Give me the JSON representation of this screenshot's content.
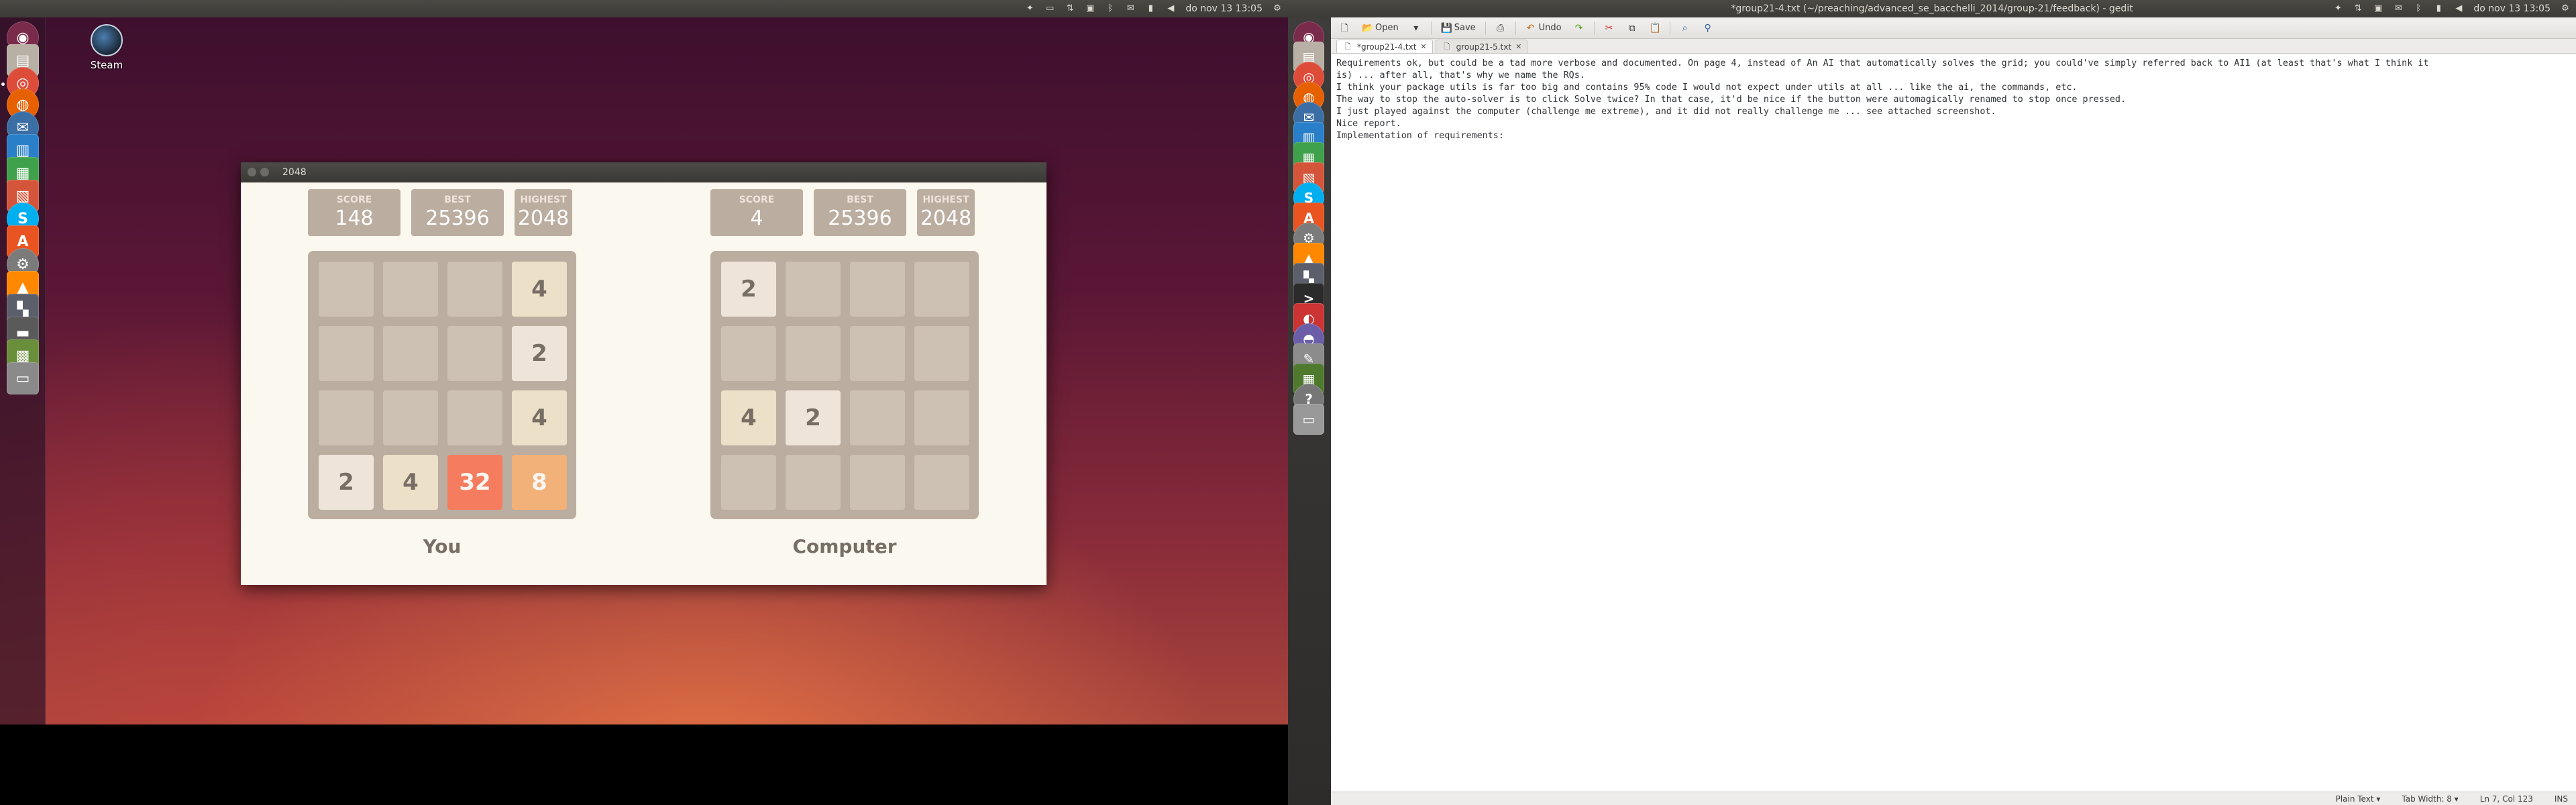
{
  "left_monitor": {
    "topbar": {
      "window_title": "",
      "clock": "do nov 13 13:05"
    },
    "desktop_icons": [
      {
        "label": "Steam",
        "icon": "steam-icon"
      }
    ],
    "launcher_icons": [
      "ubuntu-dash-icon",
      "files-icon",
      "chrome-icon",
      "firefox-icon",
      "thunderbird-icon",
      "writer-icon",
      "calc-icon",
      "impress-icon",
      "skype-icon",
      "software-center-icon",
      "system-settings-icon",
      "vlc-icon",
      "app-icon",
      "scanner-icon",
      "game-icon",
      "drive-icon"
    ],
    "game_window": {
      "title": "2048",
      "player": {
        "score_label": "SCORE",
        "score": "148",
        "best_label": "BEST",
        "best": "25396",
        "highest_label": "HIGHEST",
        "highest": "2048",
        "label": "You",
        "grid": [
          [
            "",
            "",
            "",
            "4"
          ],
          [
            "",
            "",
            "",
            "2"
          ],
          [
            "",
            "",
            "",
            "4"
          ],
          [
            "2",
            "4",
            "32",
            "8"
          ]
        ]
      },
      "computer": {
        "score_label": "SCORE",
        "score": "4",
        "best_label": "BEST",
        "best": "25396",
        "highest_label": "HIGHEST",
        "highest": "2048",
        "label": "Computer",
        "grid": [
          [
            "2",
            "",
            "",
            ""
          ],
          [
            "",
            "",
            "",
            ""
          ],
          [
            "4",
            "2",
            "",
            ""
          ],
          [
            "",
            "",
            "",
            ""
          ]
        ]
      },
      "tile_colors": {
        "empty": "#cdc1b4",
        "2": "#eee4da",
        "4": "#ede0c8",
        "8": "#f2b179",
        "32": "#f67c5f",
        "board": "#bbada0",
        "background": "#faf8ef"
      }
    }
  },
  "right_monitor": {
    "topbar": {
      "window_title": "*group21-4.txt (~/preaching/advanced_se_bacchelli_2014/group-21/feedback) - gedit",
      "clock": "do nov 13 13:05"
    },
    "launcher_icons": [
      "ubuntu-dash-icon",
      "files-icon",
      "chrome-icon",
      "firefox-icon",
      "thunderbird-icon",
      "writer-icon",
      "calc-icon",
      "impress-icon",
      "skype-icon",
      "software-center-icon",
      "system-settings-icon",
      "vlc-icon",
      "image-viewer-icon",
      "terminal-icon",
      "app-icon",
      "disk-icon",
      "text-editor-icon",
      "workspaces-icon",
      "help-icon",
      "trash-icon"
    ],
    "gedit": {
      "toolbar": {
        "open_label": "Open",
        "save_label": "Save",
        "undo_label": "Undo"
      },
      "tabs": [
        {
          "label": "*group21-4.txt",
          "active": true
        },
        {
          "label": "group21-5.txt",
          "active": false
        }
      ],
      "lines": [
        "Requirements ok, but could be a tad more verbose and documented. On page 4, instead of An AI that automatically solves the grid; you could've simply referred back to AI1 (at least that's what I think it",
        "is) ... after all, that's why we name the RQs.",
        "",
        "I think your package utils is far too big and contains 95% code I would not expect under utils at all ... like the ai, the commands, etc.",
        "",
        "The way to stop the auto-solver is to click Solve twice? In that case, it'd be nice if the button were automagically renamed to stop once pressed.",
        "",
        "I just played against the computer (challenge me extreme), and it did not really challenge me ... see attached screenshot.",
        "",
        "Nice report.",
        "",
        "Implementation of requirements:"
      ],
      "status": {
        "language": "Plain Text",
        "tab_width": "Tab Width: 8",
        "position": "Ln 7, Col 123",
        "mode": "INS"
      }
    }
  }
}
